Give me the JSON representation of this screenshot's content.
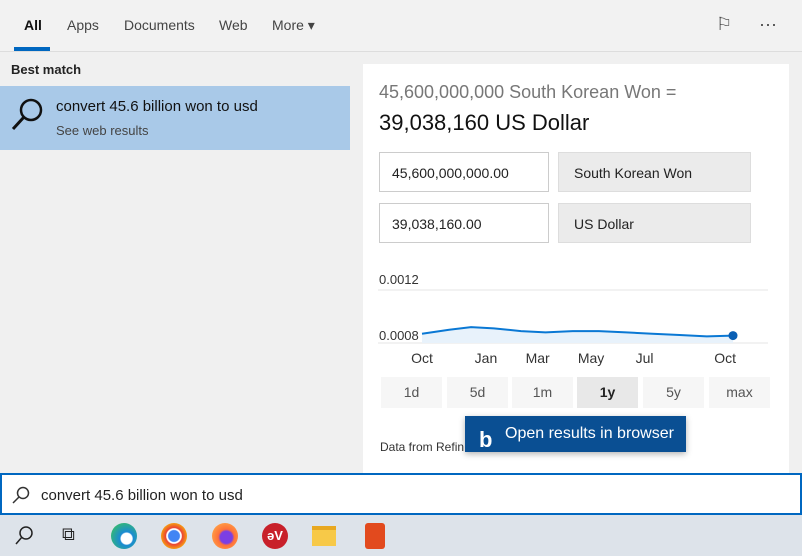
{
  "tabs": [
    {
      "label": "All"
    },
    {
      "label": "Apps"
    },
    {
      "label": "Documents"
    },
    {
      "label": "Web"
    },
    {
      "label": "More ▾"
    }
  ],
  "top_icons": [
    "feedback-icon",
    "more-options-icon"
  ],
  "left": {
    "section": "Best match",
    "result": {
      "title": "convert 45.6 billion won to usd",
      "subtitle": "See web results",
      "icon": "search-icon"
    }
  },
  "converter": {
    "from_line": "45,600,000,000 South Korean Won =",
    "to_line": "39,038,160 US Dollar",
    "from_value": "45,600,000,000.00",
    "from_currency": "South Korean Won",
    "to_value": "39,038,160.00",
    "to_currency": "US Dollar"
  },
  "ranges": [
    {
      "label": "1d"
    },
    {
      "label": "5d"
    },
    {
      "label": "1m"
    },
    {
      "label": "1y",
      "selected": true
    },
    {
      "label": "5y"
    },
    {
      "label": "max"
    }
  ],
  "data_source": "Data from Refin",
  "open_button": "Open results in browser",
  "search_query": "convert 45.6 billion won to usd",
  "accent": "#0067c0",
  "chart_data": {
    "type": "line",
    "ylim": [
      0.0008,
      0.0012
    ],
    "yticks": [
      "0.0012",
      "0.0008"
    ],
    "xticks": [
      {
        "label": "Oct",
        "x": "2020-10-20"
      },
      {
        "label": "Jan",
        "x": "2021-01-01"
      },
      {
        "label": "Mar",
        "x": "2021-03-01"
      },
      {
        "label": "May",
        "x": "2021-05-01"
      },
      {
        "label": "Jul",
        "x": "2021-07-01"
      },
      {
        "label": "Oct",
        "x": "2021-10-01"
      }
    ],
    "xlim": [
      "2020-10-20",
      "2021-10-10"
    ],
    "x": [
      "2020-10-20",
      "2020-11-20",
      "2020-12-15",
      "2021-01-10",
      "2021-02-10",
      "2021-03-10",
      "2021-04-10",
      "2021-05-10",
      "2021-06-10",
      "2021-07-10",
      "2021-08-10",
      "2021-09-10",
      "2021-10-10"
    ],
    "values": [
      0.00087,
      0.0009,
      0.00092,
      0.00091,
      0.00089,
      0.00088,
      0.00089,
      0.00089,
      0.00088,
      0.00087,
      0.00086,
      0.00085,
      0.000856
    ],
    "color": "#0a78d4"
  }
}
